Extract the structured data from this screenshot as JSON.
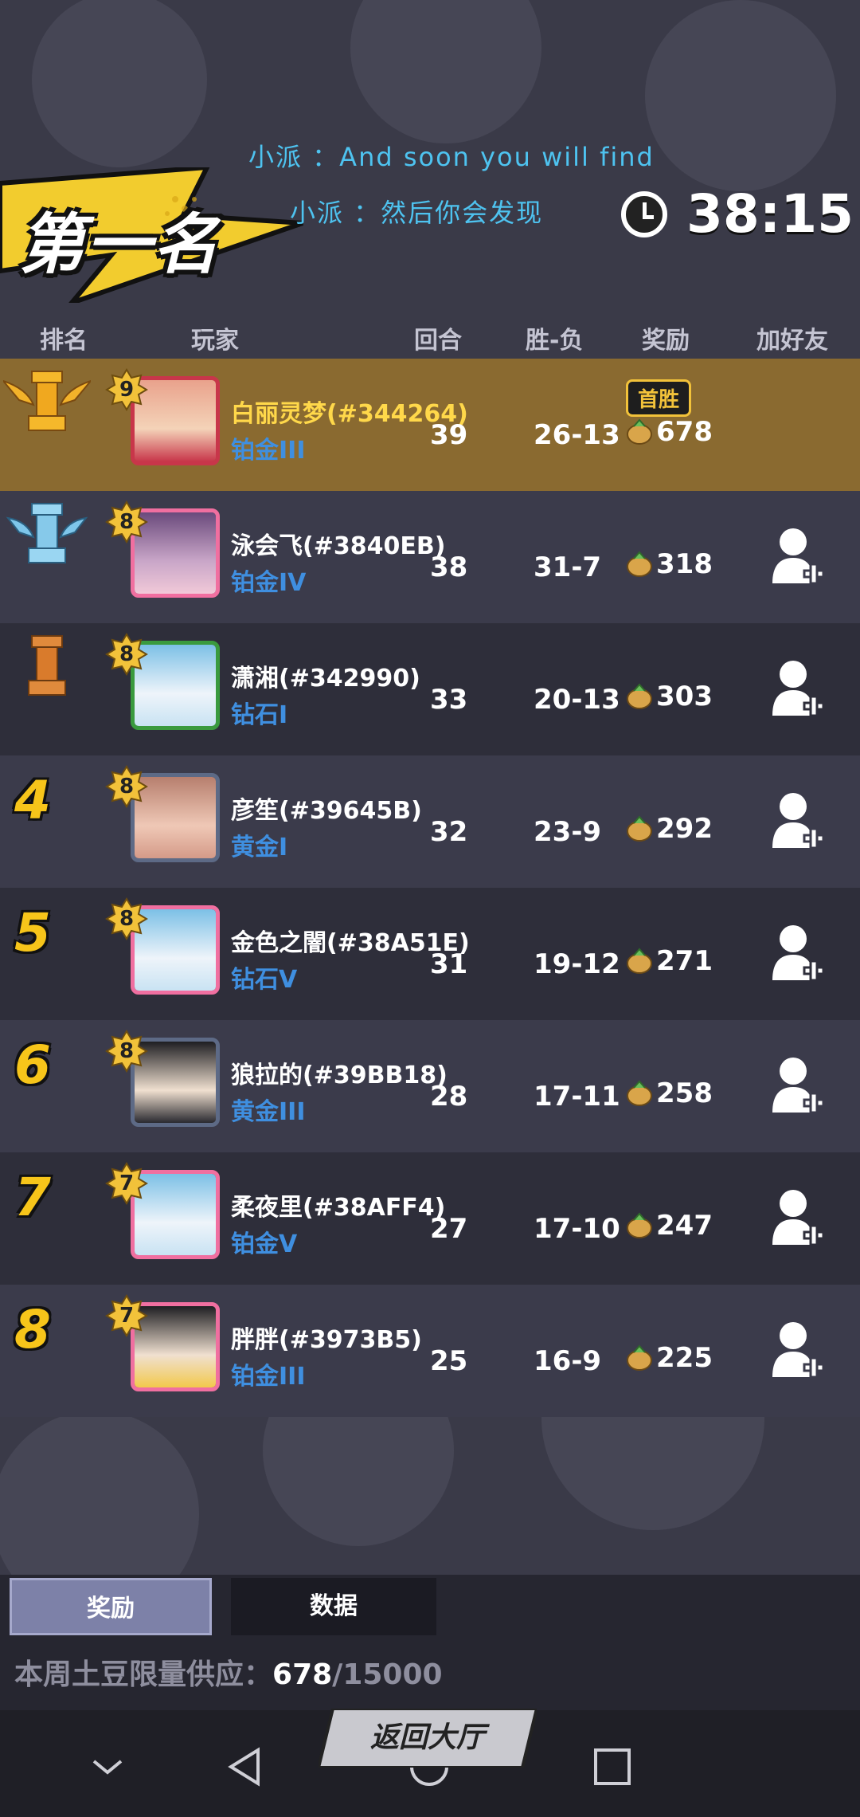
{
  "banner": {
    "title": "第一名"
  },
  "lyrics": {
    "line1": "小派 ：And soon you will find",
    "line2": "小派 ：然后你会发现"
  },
  "timer": {
    "icon": "clock-icon",
    "value": "38:15"
  },
  "headers": {
    "rank": "排名",
    "player": "玩家",
    "rounds": "回合",
    "winloss": "胜-负",
    "reward": "奖励",
    "add_friend": "加好友"
  },
  "first_win_badge": "首胜",
  "rows": [
    {
      "rank": "1",
      "level": "9",
      "name": "白丽灵梦(#344264)",
      "tier": "铂金III",
      "rounds": "39",
      "winloss": "26-13",
      "reward": "678"
    },
    {
      "rank": "2",
      "level": "8",
      "name": "泳会飞(#3840EB)",
      "tier": "铂金IV",
      "rounds": "38",
      "winloss": "31-7",
      "reward": "318"
    },
    {
      "rank": "3",
      "level": "8",
      "name": "潇湘(#342990)",
      "tier": "钻石I",
      "rounds": "33",
      "winloss": "20-13",
      "reward": "303"
    },
    {
      "rank": "4",
      "level": "8",
      "name": "彦笙(#39645B)",
      "tier": "黄金I",
      "rounds": "32",
      "winloss": "23-9",
      "reward": "292"
    },
    {
      "rank": "5",
      "level": "8",
      "name": "金色之闇(#38A51E)",
      "tier": "钻石V",
      "rounds": "31",
      "winloss": "19-12",
      "reward": "271"
    },
    {
      "rank": "6",
      "level": "8",
      "name": "狼拉的(#39BB18)",
      "tier": "黄金III",
      "rounds": "28",
      "winloss": "17-11",
      "reward": "258"
    },
    {
      "rank": "7",
      "level": "7",
      "name": "柔夜里(#38AFF4)",
      "tier": "铂金V",
      "rounds": "27",
      "winloss": "17-10",
      "reward": "247"
    },
    {
      "rank": "8",
      "level": "7",
      "name": "胖胖(#3973B5)",
      "tier": "铂金III",
      "rounds": "25",
      "winloss": "16-9",
      "reward": "225"
    }
  ],
  "tabs": {
    "reward": "奖励",
    "data": "数据"
  },
  "supply": {
    "label": "本周土豆限量供应：",
    "current": "678",
    "total": "/15000"
  },
  "back_button": "返回大厅",
  "colors": {
    "gold_row": "#8a6a30",
    "accent_blue": "#4ec3f0",
    "tier_blue": "#3f8fe0",
    "rank_yellow": "#f7c51a"
  }
}
